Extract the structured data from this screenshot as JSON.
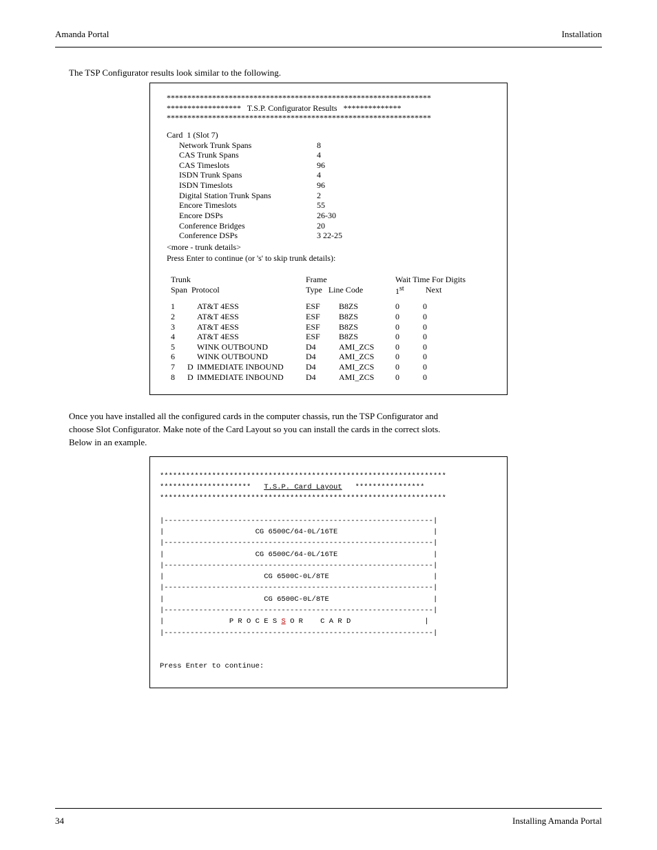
{
  "header": {
    "left": "Amanda Portal",
    "right": "Installation"
  },
  "footer": {
    "left": "34",
    "right": "Installing Amanda Portal"
  },
  "intro_caption": "The TSP Configurator results look similar to the following.",
  "results": {
    "title_center": "T.S.P. Configurator Results",
    "aster18": "******************",
    "aster14": "**************",
    "aster_full_top": "****************************************************************",
    "aster_full_bot": "****************************************************************",
    "card_line": "Card  1 (Slot 7)",
    "stats": [
      {
        "label": "Network Trunk Spans",
        "value": "8"
      },
      {
        "label": "CAS Trunk Spans",
        "value": "4"
      },
      {
        "label": "CAS Timeslots",
        "value": "96"
      },
      {
        "label": "ISDN Trunk Spans",
        "value": "4"
      },
      {
        "label": "ISDN Timeslots",
        "value": "96"
      },
      {
        "label": "Digital Station Trunk Spans",
        "value": "2"
      },
      {
        "label": "Encore Timeslots",
        "value": "55"
      },
      {
        "label": "Encore DSPs",
        "value": "26-30"
      },
      {
        "label": "Conference Bridges",
        "value": "20"
      },
      {
        "label": "Conference DSPs",
        "value": "3 22-25"
      }
    ],
    "more_line": "<more - trunk details>",
    "prompt_line": "Press Enter to continue (or 's' to skip trunk details):",
    "tbl_hdr": {
      "trunk": "Trunk",
      "span_proto": "Span  Protocol",
      "frame": "Frame",
      "type_line": "Type   Line Code",
      "wait": "Wait Time For Digits",
      "first": "1",
      "first_sup": "st",
      "next": "Next"
    },
    "rows": [
      {
        "span": "1",
        "d": "",
        "proto": "AT&T 4ESS",
        "ft": "ESF",
        "lc": "B8ZS",
        "w1": "0",
        "w2": "0"
      },
      {
        "span": "2",
        "d": "",
        "proto": "AT&T 4ESS",
        "ft": "ESF",
        "lc": "B8ZS",
        "w1": "0",
        "w2": "0"
      },
      {
        "span": "3",
        "d": "",
        "proto": "AT&T 4ESS",
        "ft": "ESF",
        "lc": "B8ZS",
        "w1": "0",
        "w2": "0"
      },
      {
        "span": "4",
        "d": "",
        "proto": "AT&T 4ESS",
        "ft": "ESF",
        "lc": "B8ZS",
        "w1": "0",
        "w2": "0"
      },
      {
        "span": "5",
        "d": "",
        "proto": "WINK OUTBOUND",
        "ft": "D4",
        "lc": "AMI_ZCS",
        "w1": "0",
        "w2": "0"
      },
      {
        "span": "6",
        "d": "",
        "proto": "WINK OUTBOUND",
        "ft": "D4",
        "lc": "AMI_ZCS",
        "w1": "0",
        "w2": "0"
      },
      {
        "span": "7",
        "d": "D",
        "proto": "IMMEDIATE INBOUND",
        "ft": "D4",
        "lc": "AMI_ZCS",
        "w1": "0",
        "w2": "0"
      },
      {
        "span": "8",
        "d": "D",
        "proto": "IMMEDIATE INBOUND",
        "ft": "D4",
        "lc": "AMI_ZCS",
        "w1": "0",
        "w2": "0"
      }
    ]
  },
  "layout_para": "Once you have installed all the configured cards in the computer chassis, run the TSP Configurator and choose Slot Configurator.  Make note of the Card Layout so you can install the cards in the correct slots.  Below in an example.",
  "layout": {
    "aster_full": "******************************************************************",
    "aster21": "*********************",
    "aster16": "****************",
    "title_underlined": "T.S.P. Card Layout",
    "dashes_pipe": "|--------------------------------------------------------------|",
    "row_prefix": "|                   ",
    "row_suffix_pad": "                          |",
    "rows": [
      "CG 6500C/64-0L/16TE",
      "CG 6500C/64-0L/16TE",
      "CG 6500C-0L/8TE",
      "CG 6500C-0L/8TE"
    ],
    "proc_prefix": "|               ",
    "proc_pre": "P R O C E S ",
    "proc_red": "S",
    "proc_post": " O R    C A R D",
    "proc_suffix": "                 |",
    "prompt": "Press Enter to continue:"
  }
}
